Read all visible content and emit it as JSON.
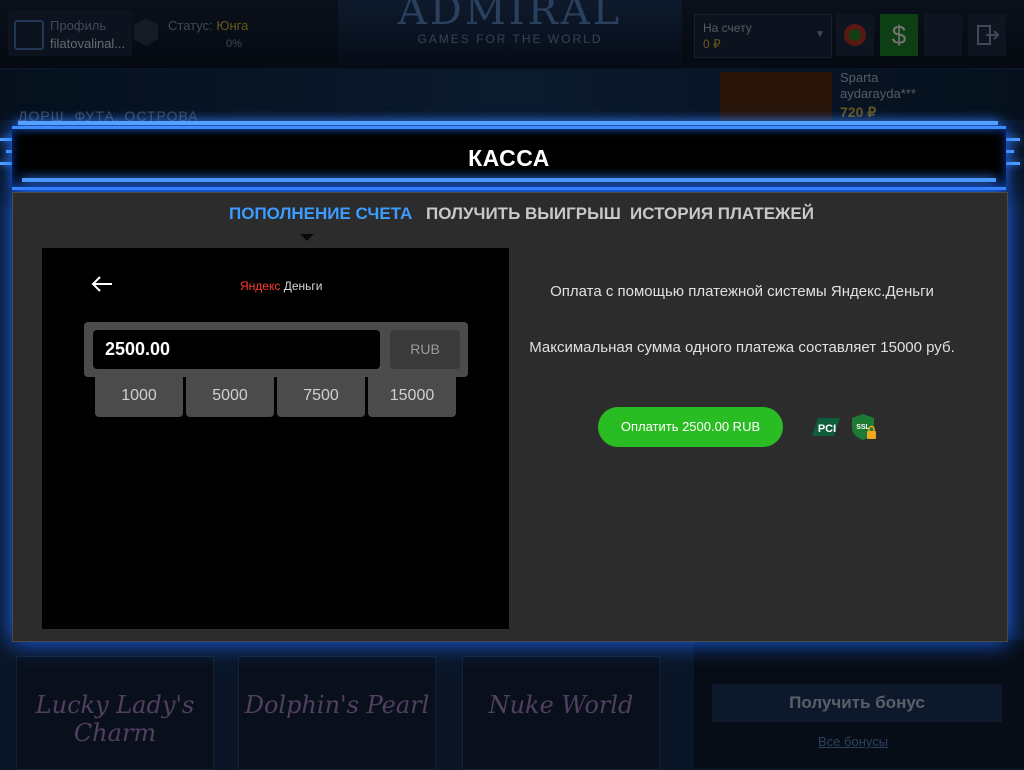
{
  "header": {
    "profile_label": "Профиль",
    "profile_name": "filatovalinal...",
    "status_label": "Статус:",
    "status_value": "Юнга",
    "status_progress": "0%",
    "logo_title": "ADMIRAL",
    "logo_subtitle": "GAMES FOR THE WORLD",
    "account_label": "На счету",
    "account_value": "0 ₽",
    "dollar_icon": "$"
  },
  "background": {
    "strip_label": "ДОРШ, ФУТА, ОСТРОВА",
    "promo_name": "Sparta",
    "promo_user": "aydarayda***",
    "promo_amount": "720 ₽",
    "games": [
      "Lucky Lady's Charm",
      "Dolphin's Pearl",
      "Nuke World"
    ],
    "bonus_button": "Получить бонус",
    "bonus_link": "Все бонусы"
  },
  "modal": {
    "title": "КАССА",
    "tabs": [
      {
        "label": "ПОПОЛНЕНИЕ СЧЕТА",
        "active": true
      },
      {
        "label": "ПОЛУЧИТЬ ВЫИГРЫШ",
        "active": false
      },
      {
        "label": "ИСТОРИЯ ПЛАТЕЖЕЙ",
        "active": false
      }
    ],
    "payment": {
      "back_icon": "arrow-left-icon",
      "provider_logo_part1": "Яндекс",
      "provider_logo_part2": " Деньги",
      "amount_value": "2500.00",
      "currency": "RUB",
      "presets": [
        "1000",
        "5000",
        "7500",
        "15000"
      ],
      "info_line1": "Оплата с помощью платежной системы Яндекс.Деньги",
      "info_line2": "Максимальная сумма одного платежа составляет 15000 руб.",
      "pay_button": "Оплатить 2500.00 RUB",
      "pci_label": "PCI",
      "ssl_label": "SSL"
    }
  },
  "colors": {
    "accent_blue": "#3c9cff",
    "pay_green": "#29bd23",
    "modal_bg": "#2c2c2c",
    "glow": "#3f8cff"
  }
}
